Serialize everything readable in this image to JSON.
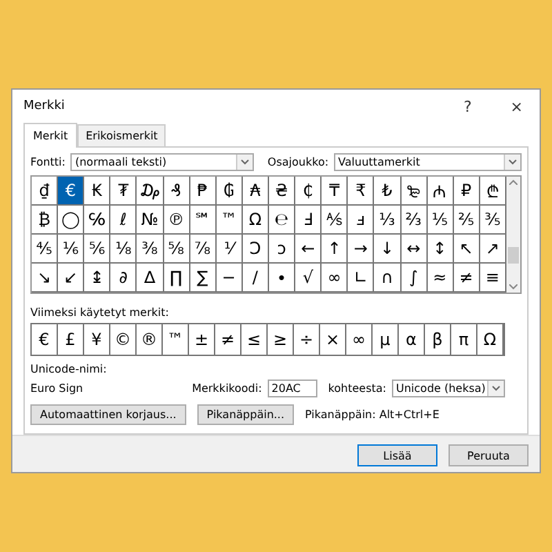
{
  "window": {
    "title": "Merkki",
    "help": "?",
    "close": "×"
  },
  "tabs": [
    {
      "label": "Merkit",
      "selected": true
    },
    {
      "label": "Erikoismerkit",
      "selected": false
    }
  ],
  "font": {
    "label": "Fontti:",
    "value": "(normaali teksti)"
  },
  "subset": {
    "label": "Osajoukko:",
    "value": "Valuuttamerkit"
  },
  "symbol_rows": [
    {
      "cells": [
        {
          "char": "₫",
          "selected": false
        },
        {
          "char": "€",
          "selected": true
        },
        {
          "char": "₭",
          "selected": false
        },
        {
          "char": "₮",
          "selected": false
        },
        {
          "char": "₯",
          "selected": false
        },
        {
          "char": "₰",
          "selected": false
        },
        {
          "char": "₱",
          "selected": false
        },
        {
          "char": "₲",
          "selected": false
        },
        {
          "char": "₳",
          "selected": false
        },
        {
          "char": "₴",
          "selected": false
        },
        {
          "char": "₵",
          "selected": false
        },
        {
          "char": "₸",
          "selected": false
        },
        {
          "char": "₹",
          "selected": false
        },
        {
          "char": "₺",
          "selected": false
        },
        {
          "char": "₻",
          "selected": false
        },
        {
          "char": "₼",
          "selected": false
        },
        {
          "char": "₽",
          "selected": false
        },
        {
          "char": "₾",
          "selected": false
        }
      ]
    },
    {
      "cells": [
        {
          "char": "₿",
          "selected": false
        },
        {
          "char": "◯",
          "selected": false
        },
        {
          "char": "℅",
          "selected": false
        },
        {
          "char": "ℓ",
          "selected": false
        },
        {
          "char": "№",
          "selected": false
        },
        {
          "char": "℗",
          "selected": false
        },
        {
          "char": "℠",
          "selected": false
        },
        {
          "char": "™",
          "selected": false
        },
        {
          "char": "Ω",
          "selected": false
        },
        {
          "char": "℮",
          "selected": false
        },
        {
          "char": "Ⅎ",
          "selected": false
        },
        {
          "char": "⅍",
          "selected": false
        },
        {
          "char": "ⅎ",
          "selected": false
        },
        {
          "char": "⅓",
          "selected": false
        },
        {
          "char": "⅔",
          "selected": false
        },
        {
          "char": "⅕",
          "selected": false
        },
        {
          "char": "⅖",
          "selected": false
        },
        {
          "char": "⅗",
          "selected": false
        }
      ]
    },
    {
      "cells": [
        {
          "char": "⅘",
          "selected": false
        },
        {
          "char": "⅙",
          "selected": false
        },
        {
          "char": "⅚",
          "selected": false
        },
        {
          "char": "⅛",
          "selected": false
        },
        {
          "char": "⅜",
          "selected": false
        },
        {
          "char": "⅝",
          "selected": false
        },
        {
          "char": "⅞",
          "selected": false
        },
        {
          "char": "⅟",
          "selected": false
        },
        {
          "char": "Ↄ",
          "selected": false
        },
        {
          "char": "ↄ",
          "selected": false
        },
        {
          "char": "←",
          "selected": false
        },
        {
          "char": "↑",
          "selected": false
        },
        {
          "char": "→",
          "selected": false
        },
        {
          "char": "↓",
          "selected": false
        },
        {
          "char": "↔",
          "selected": false
        },
        {
          "char": "↕",
          "selected": false
        },
        {
          "char": "↖",
          "selected": false
        },
        {
          "char": "↗",
          "selected": false
        }
      ]
    },
    {
      "cells": [
        {
          "char": "↘",
          "selected": false
        },
        {
          "char": "↙",
          "selected": false
        },
        {
          "char": "↨",
          "selected": false
        },
        {
          "char": "∂",
          "selected": false
        },
        {
          "char": "∆",
          "selected": false
        },
        {
          "char": "∏",
          "selected": false
        },
        {
          "char": "∑",
          "selected": false
        },
        {
          "char": "−",
          "selected": false
        },
        {
          "char": "∕",
          "selected": false
        },
        {
          "char": "∙",
          "selected": false
        },
        {
          "char": "√",
          "selected": false
        },
        {
          "char": "∞",
          "selected": false
        },
        {
          "char": "∟",
          "selected": false
        },
        {
          "char": "∩",
          "selected": false
        },
        {
          "char": "∫",
          "selected": false
        },
        {
          "char": "≈",
          "selected": false
        },
        {
          "char": "≠",
          "selected": false
        },
        {
          "char": "≡",
          "selected": false
        }
      ]
    }
  ],
  "recent": {
    "label": "Viimeksi käytetyt merkit:",
    "symbols": [
      "€",
      "£",
      "¥",
      "©",
      "®",
      "™",
      "±",
      "≠",
      "≤",
      "≥",
      "÷",
      "×",
      "∞",
      "µ",
      "α",
      "β",
      "π",
      "Ω"
    ]
  },
  "unicode_name": {
    "label": "Unicode-nimi:",
    "value": "Euro Sign"
  },
  "char_code": {
    "label": "Merkkikoodi:",
    "value": "20AC"
  },
  "from": {
    "label": "kohteesta:",
    "value": "Unicode (heksa)"
  },
  "actions": [
    "Automaattinen korjaus...",
    "Pikanäppäin..."
  ],
  "shortcut_text": "Pikanäppäin: Alt+Ctrl+E",
  "footer_buttons": [
    {
      "label": "Lisää",
      "default": true
    },
    {
      "label": "Peruuta",
      "default": false
    }
  ]
}
